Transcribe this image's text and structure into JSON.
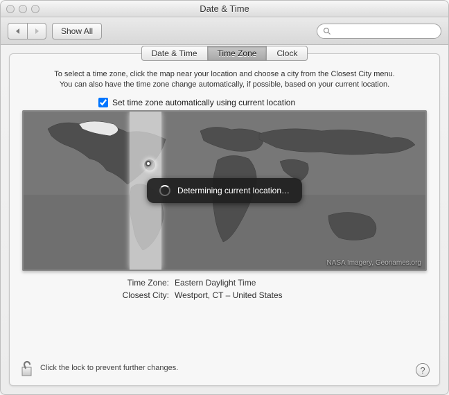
{
  "window": {
    "title": "Date & Time"
  },
  "toolbar": {
    "back_label": "◀",
    "forward_label": "▶",
    "showall_label": "Show All",
    "search_placeholder": ""
  },
  "tabs": [
    {
      "label": "Date & Time",
      "active": false
    },
    {
      "label": "Time Zone",
      "active": true
    },
    {
      "label": "Clock",
      "active": false
    }
  ],
  "instructions": {
    "line1": "To select a time zone, click the map near your location and choose a city from the Closest City menu.",
    "line2": "You can also have the time zone change automatically, if possible, based on your current location."
  },
  "auto_checkbox": {
    "checked": true,
    "label": "Set time zone automatically using current location"
  },
  "map": {
    "overlay_text": "Determining current location…",
    "attribution": "NASA Imagery, Geonames.org"
  },
  "info": {
    "tz_label": "Time Zone:",
    "tz_value": "Eastern Daylight Time",
    "city_label": "Closest City:",
    "city_value": "Westport, CT – United States"
  },
  "lock": {
    "text": "Click the lock to prevent further changes."
  },
  "help": {
    "glyph": "?"
  }
}
